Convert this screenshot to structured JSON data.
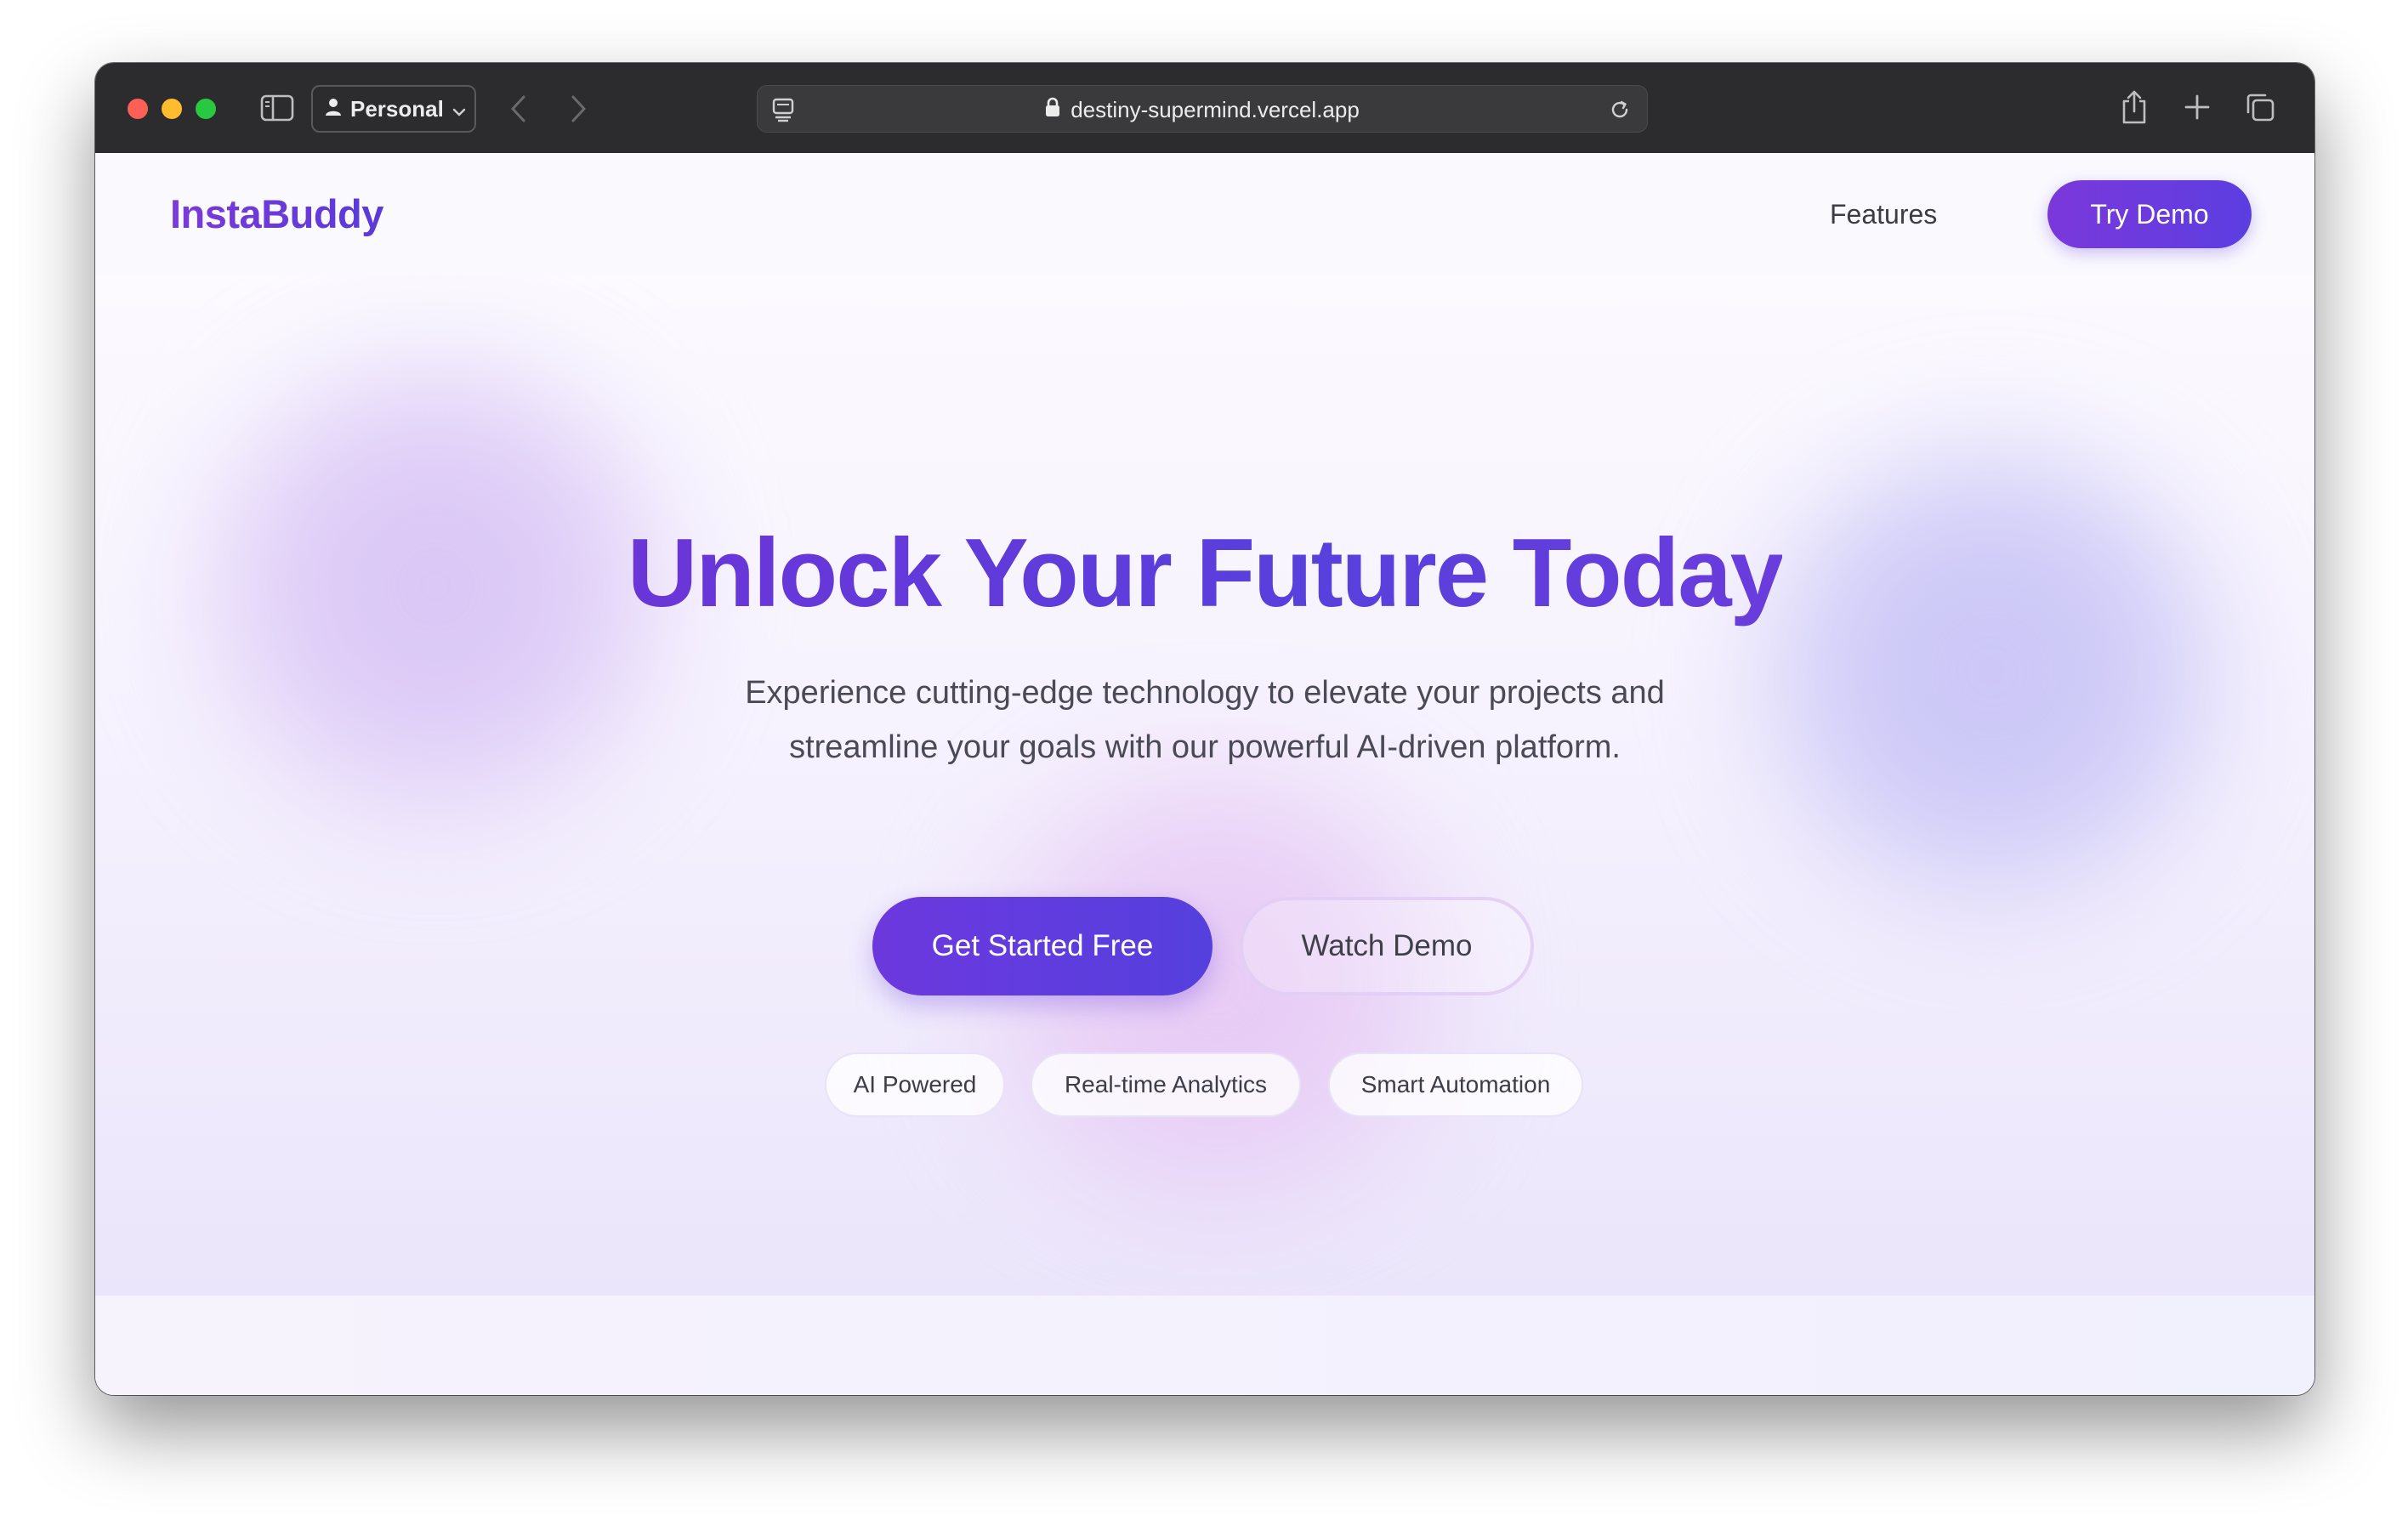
{
  "browser": {
    "profile_label": "Personal",
    "url": "destiny-supermind.vercel.app",
    "icons": [
      "sidebar-icon",
      "person-icon",
      "chevron-down-icon",
      "back-arrow-icon",
      "forward-arrow-icon",
      "site-settings-icon",
      "lock-icon",
      "reload-icon",
      "share-icon",
      "plus-icon",
      "tabs-overview-icon"
    ]
  },
  "nav": {
    "logo": "InstaBuddy",
    "features_link": "Features",
    "try_demo_button": "Try Demo"
  },
  "hero": {
    "title": "Unlock Your Future Today",
    "subtitle_line1": "Experience cutting-edge technology to elevate your projects and",
    "subtitle_line2": "streamline your goals with our powerful AI-driven platform.",
    "primary_cta": "Get Started Free",
    "secondary_cta": "Watch Demo",
    "chips": [
      "AI Powered",
      "Real-time Analytics",
      "Smart Automation"
    ]
  },
  "colors": {
    "accent_purple": "#6c38de",
    "accent_indigo": "#5540dd",
    "titlebar": "#2c2c2e"
  }
}
